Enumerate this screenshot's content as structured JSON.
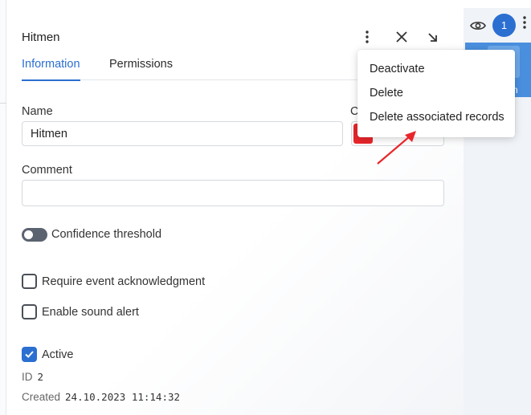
{
  "panel": {
    "title": "Hitmen",
    "tabs": [
      {
        "label": "Information",
        "active": true
      },
      {
        "label": "Permissions",
        "active": false
      }
    ]
  },
  "form": {
    "name_label": "Name",
    "name_value": "Hitmen",
    "color_label_partial": "C",
    "color_value": "#e8262b",
    "comment_label": "Comment",
    "comment_value": "",
    "confidence_label": "Confidence threshold",
    "confidence_enabled": false,
    "require_ack_label": "Require event acknowledgment",
    "require_ack_checked": false,
    "sound_alert_label": "Enable sound alert",
    "sound_alert_checked": false,
    "active_label": "Active",
    "active_checked": true
  },
  "meta": {
    "id_label": "ID",
    "id_value": "2",
    "created_label": "Created",
    "created_value": "24.10.2023 11:14:32"
  },
  "dropdown_menu": {
    "items": [
      "Deactivate",
      "Delete",
      "Delete associated records"
    ]
  },
  "right_panel": {
    "badge_count": "1",
    "partial_text": "n"
  },
  "colors": {
    "accent": "#2b6fd1",
    "swatch": "#e8262b",
    "arrow": "#e8262b"
  }
}
